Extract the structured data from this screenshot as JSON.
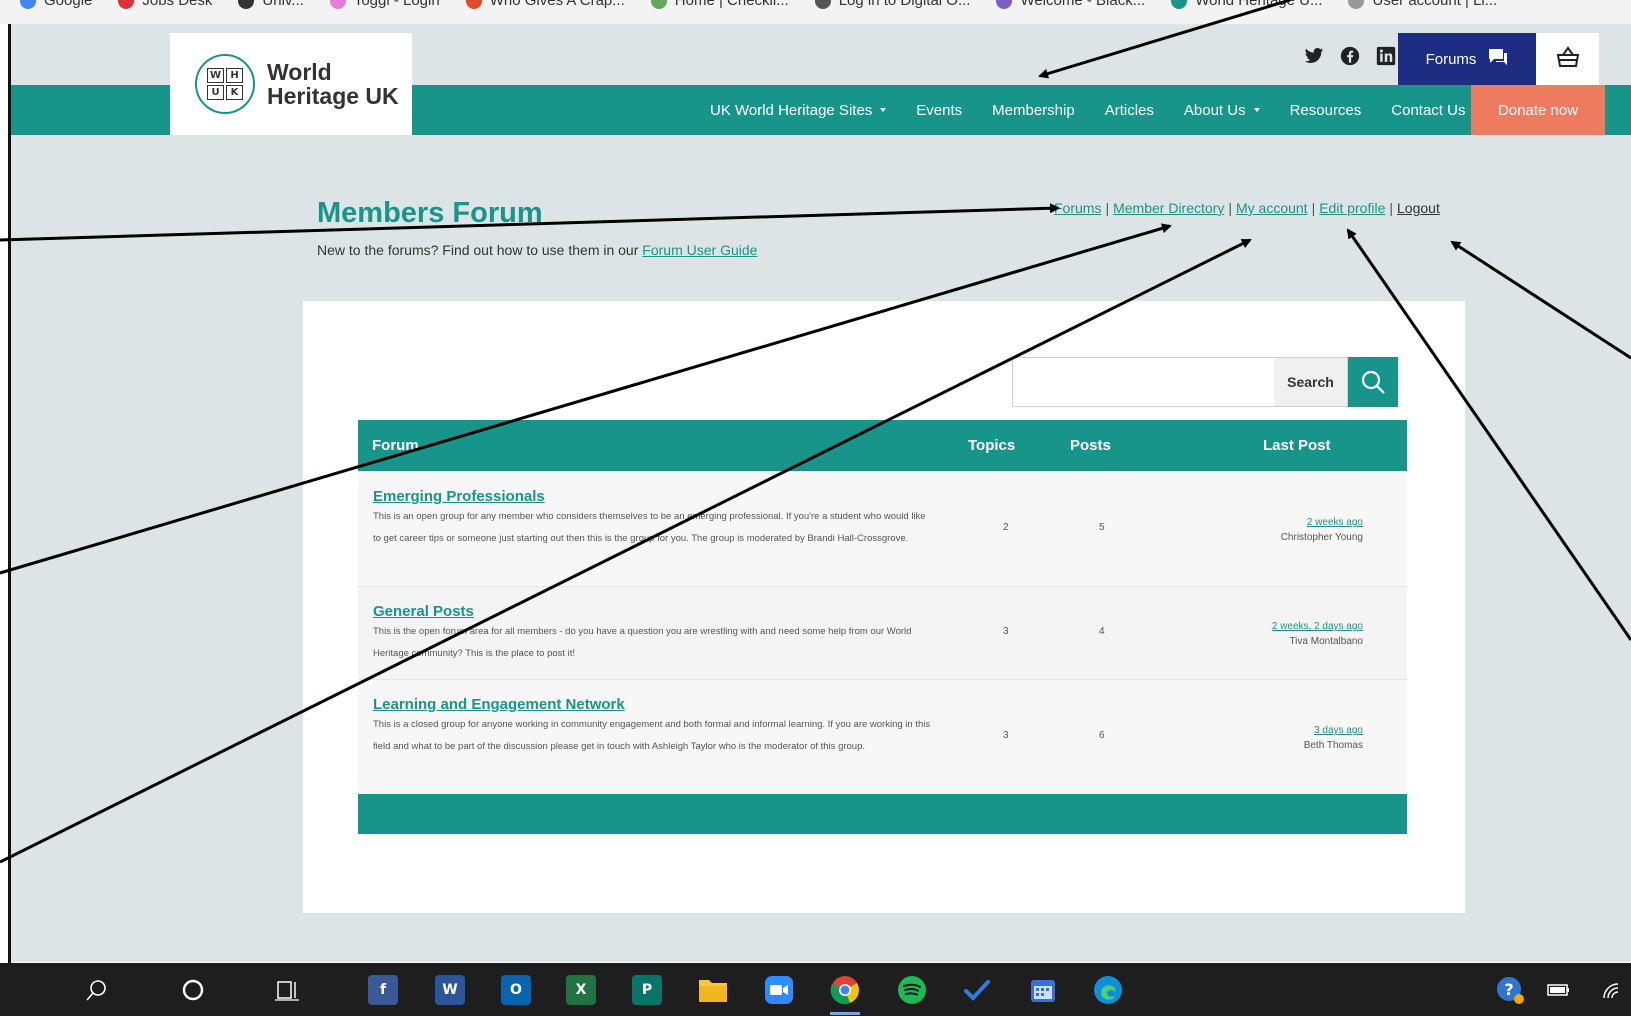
{
  "browser": {
    "bookmarks": [
      {
        "label": "Google",
        "color": "#4285f4"
      },
      {
        "label": "Jobs Desk",
        "color": "#d33"
      },
      {
        "label": "Univ...",
        "color": "#333"
      },
      {
        "label": "Toggl - Login",
        "color": "#e57cd8"
      },
      {
        "label": "Who Gives A Crap...",
        "color": "#e04b2b"
      },
      {
        "label": "Home | Checkli...",
        "color": "#5fa85c"
      },
      {
        "label": "Log in to Digital O...",
        "color": "#555"
      },
      {
        "label": "Welcome - Black...",
        "color": "#7a5fc9"
      },
      {
        "label": "World Heritage U...",
        "color": "#17958a"
      },
      {
        "label": "User account | Li...",
        "color": "#999"
      }
    ]
  },
  "header": {
    "logo_cells": [
      "W",
      "H",
      "U",
      "K"
    ],
    "logo_line1": "World",
    "logo_line2": "Heritage UK",
    "forums_button": "Forums",
    "nav": [
      {
        "label": "UK World Heritage Sites",
        "dropdown": true
      },
      {
        "label": "Events",
        "dropdown": false
      },
      {
        "label": "Membership",
        "dropdown": false
      },
      {
        "label": "Articles",
        "dropdown": false
      },
      {
        "label": "About Us",
        "dropdown": true
      },
      {
        "label": "Resources",
        "dropdown": false
      },
      {
        "label": "Contact Us",
        "dropdown": false
      }
    ],
    "donate": "Donate now",
    "colors": {
      "teal": "#17958a",
      "navy": "#1d2d82",
      "coral": "#ee7a5f"
    }
  },
  "forum": {
    "title": "Members Forum",
    "intro_text": "New to the forums? Find out how to use them in our ",
    "intro_link": "Forum User Guide",
    "account_links": {
      "forums": "Forums",
      "directory": "Member Directory",
      "account": "My account",
      "edit": "Edit profile",
      "logout": "Logout",
      "separator": "|"
    },
    "search": {
      "placeholder": "",
      "button": "Search"
    },
    "table": {
      "headers": {
        "forum": "Forum",
        "topics": "Topics",
        "posts": "Posts",
        "last_post": "Last Post"
      },
      "rows": [
        {
          "title": "Emerging Professionals",
          "description": "This is an open group for any member who considers themselves to be an emerging professional. If you're a student who would like to get career tips or someone just starting out then this is the group for you. The group is moderated by Brandi Hall-Crossgrove.",
          "topics": "2",
          "posts": "5",
          "last_post_when": "2 weeks ago",
          "last_post_by": "Christopher Young"
        },
        {
          "title": "General Posts",
          "description": "This is the open forum area for all members - do you have a question you are wrestling with and need some help from our World Heritage community? This is the place to post it!",
          "topics": "3",
          "posts": "4",
          "last_post_when": "2 weeks, 2 days ago",
          "last_post_by": "Tiva Montalbano"
        },
        {
          "title": "Learning and Engagement Network",
          "description": "This is a closed group for anyone working in community engagement and both formal and informal learning. If you are working in this field and what to be part of the discussion please get in touch with Ashleigh Taylor who is the moderator of this group.",
          "topics": "3",
          "posts": "6",
          "last_post_when": "3 days ago",
          "last_post_by": "Beth Thomas"
        }
      ]
    }
  },
  "taskbar": {
    "apps": [
      {
        "name": "search",
        "letter": ""
      },
      {
        "name": "cortana",
        "letter": ""
      },
      {
        "name": "task-view",
        "letter": ""
      },
      {
        "name": "facebook",
        "letter": "f",
        "color": "#3b5998"
      },
      {
        "name": "word",
        "letter": "W",
        "color": "#2b579a"
      },
      {
        "name": "outlook",
        "letter": "O",
        "color": "#0a64ad"
      },
      {
        "name": "excel",
        "letter": "X",
        "color": "#217346"
      },
      {
        "name": "publisher",
        "letter": "P",
        "color": "#077568"
      },
      {
        "name": "file-explorer",
        "letter": "",
        "color": "#f8c63d"
      },
      {
        "name": "zoom",
        "letter": "",
        "color": "#2d8cff"
      },
      {
        "name": "chrome",
        "letter": "",
        "color": "#db4437"
      },
      {
        "name": "spotify",
        "letter": "",
        "color": "#1db954"
      },
      {
        "name": "todo",
        "letter": "✔",
        "color": "#2564cf"
      },
      {
        "name": "calendar",
        "letter": "",
        "color": "#3a6fd8"
      },
      {
        "name": "edge",
        "letter": "",
        "color": "#0f8fd6"
      }
    ]
  }
}
